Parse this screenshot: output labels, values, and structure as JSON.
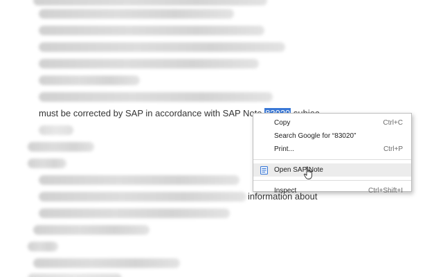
{
  "document": {
    "line_prefix": "must be corrected by SAP in accordance with SAP Note ",
    "selected_note": "83020",
    "line_suffix": " subjec",
    "right_fragment": "information about"
  },
  "context_menu": {
    "items": [
      {
        "label": "Copy",
        "shortcut": "Ctrl+C"
      },
      {
        "label": "Search Google for “83020”",
        "shortcut": ""
      },
      {
        "label": "Print...",
        "shortcut": "Ctrl+P"
      },
      {
        "label": "Open SAP Note",
        "shortcut": "",
        "icon": "document-icon"
      },
      {
        "label": "Inspect",
        "shortcut": "Ctrl+Shift+I"
      }
    ]
  },
  "colors": {
    "selection": "#3a78d6",
    "menu_highlight": "#ececec",
    "menu_icon": "#3a78d6"
  }
}
